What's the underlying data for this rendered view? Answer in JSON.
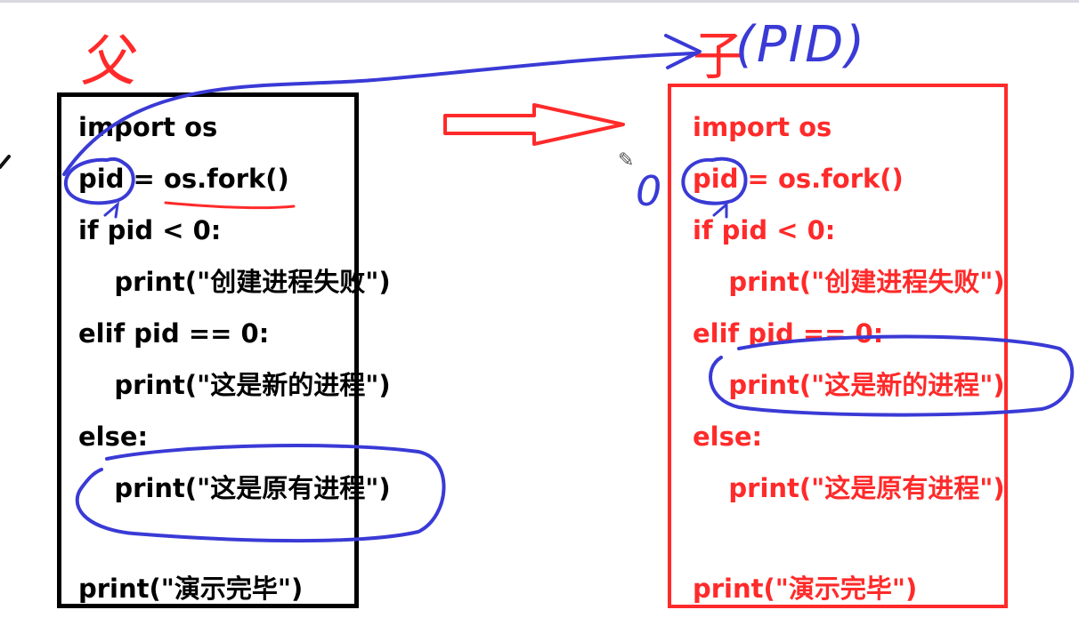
{
  "labels": {
    "parent": "父",
    "child": "子",
    "pid": "(PID)",
    "zero": "0"
  },
  "parent_code": {
    "lines": [
      "import os",
      "pid = os.fork()",
      "if pid < 0:",
      "    print(\"创建进程失败\")",
      "elif pid == 0:",
      "    print(\"这是新的进程\")",
      "else:",
      "    print(\"这是原有进程\")",
      "print(\"演示完毕\")"
    ]
  },
  "child_code": {
    "lines": [
      "import os",
      "pid = os.fork()",
      "if pid < 0:",
      "    print(\"创建进程失败\")",
      "elif pid == 0:",
      "    print(\"这是新的进程\")",
      "else:",
      "    print(\"这是原有进程\")",
      "print(\"演示完毕\")"
    ]
  },
  "colors": {
    "parent_text": "#000000",
    "child_text": "#ff2a2a",
    "annotation_blue": "#3a3ad6",
    "annotation_red": "#ff2a2a"
  },
  "icons": {
    "cursor": "pencil-icon"
  }
}
